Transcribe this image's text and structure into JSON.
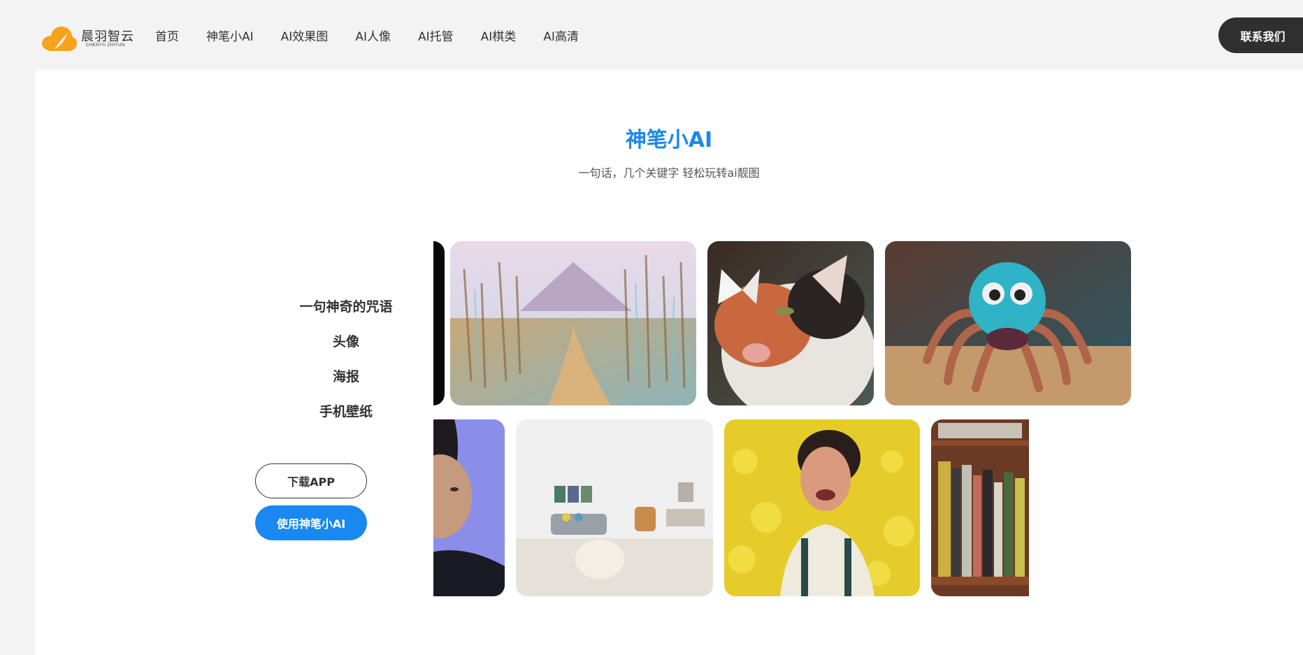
{
  "brand": {
    "name": "晨羽智云",
    "sub": "CHENYU ZHIYUN",
    "color": "#f7a21b"
  },
  "nav": {
    "items": [
      {
        "label": "首页"
      },
      {
        "label": "神笔小AI"
      },
      {
        "label": "AI效果图"
      },
      {
        "label": "AI人像"
      },
      {
        "label": "AI托管"
      },
      {
        "label": "AI棋类"
      },
      {
        "label": "AI高清"
      }
    ],
    "contact_label": "联系我们"
  },
  "hero": {
    "title": "神笔小AI",
    "subtitle": "一句话，几个关键字 轻松玩转ai靓图",
    "accent": "#1a88f0"
  },
  "categories": [
    {
      "label": "一句神奇的咒语"
    },
    {
      "label": "头像"
    },
    {
      "label": "海报"
    },
    {
      "label": "手机壁纸"
    }
  ],
  "buttons": {
    "download": "下载APP",
    "use": "使用神笔小AI"
  },
  "gallery": {
    "row1": [
      {
        "subject": "dark-card"
      },
      {
        "subject": "impressionist-forest-painting"
      },
      {
        "subject": "cat-with-butterfly"
      },
      {
        "subject": "fuzzy-blue-spider-toy"
      }
    ],
    "row2": [
      {
        "subject": "woman-portrait-blue-background"
      },
      {
        "subject": "living-room-interior"
      },
      {
        "subject": "laughing-woman-in-flower-field"
      },
      {
        "subject": "bookshelf"
      }
    ]
  }
}
